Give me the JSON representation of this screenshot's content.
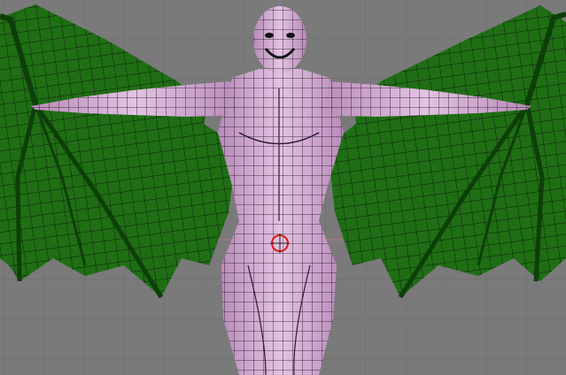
{
  "viewport": {
    "kind": "3d-view-front-ortho",
    "background_color": "#7a7a7a",
    "grid_color": "#6c6c6c",
    "x_axis_color": "#c27a7a",
    "z_axis_color": "#7a7ad0"
  },
  "scene": {
    "object": "winged-creature-mesh",
    "display_mode": "solid-with-wireframe",
    "body_color": "#d9b3d9",
    "body_shade_color": "#b88ab8",
    "wing_color": "#1f6e14",
    "wing_dark_color": "#0d3f08",
    "wire_color": "#121212",
    "cursor_color": "#e01a1a",
    "cursor_icon": "3d-cursor-icon"
  }
}
